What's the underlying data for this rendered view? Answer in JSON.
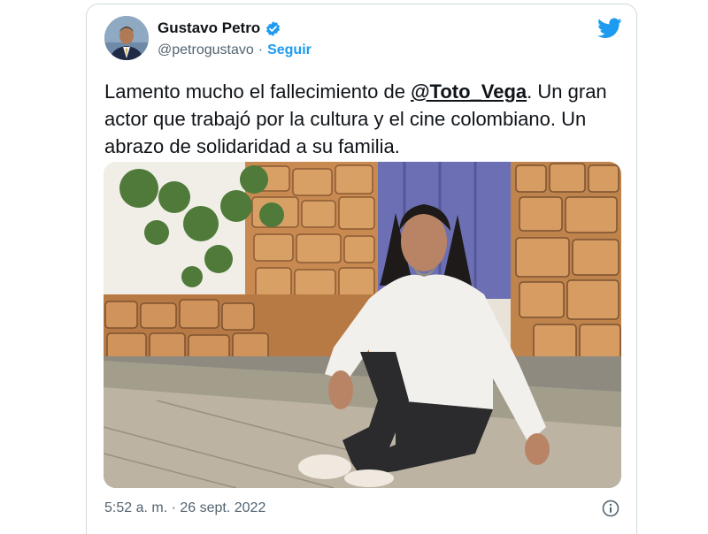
{
  "author": {
    "display_name": "Gustavo Petro",
    "handle": "@petrogustavo",
    "separator": "·",
    "follow_label": "Seguir",
    "verified": true
  },
  "tweet": {
    "text_before": "Lamento mucho el fallecimiento de ",
    "mention": "@Toto_Vega",
    "text_after": ". Un gran actor que trabajó por la cultura y el cine colombiano. Un abrazo de solidaridad a su familia."
  },
  "meta": {
    "timestamp": "5:52 a. m. · 26 sept. 2022"
  },
  "icons": {
    "logo": "twitter-bird-icon",
    "verified": "verified-badge-icon",
    "info": "info-icon"
  },
  "colors": {
    "accent": "#1d9bf0",
    "text": "#0f1419",
    "muted": "#536471",
    "border": "#cfd9de"
  }
}
